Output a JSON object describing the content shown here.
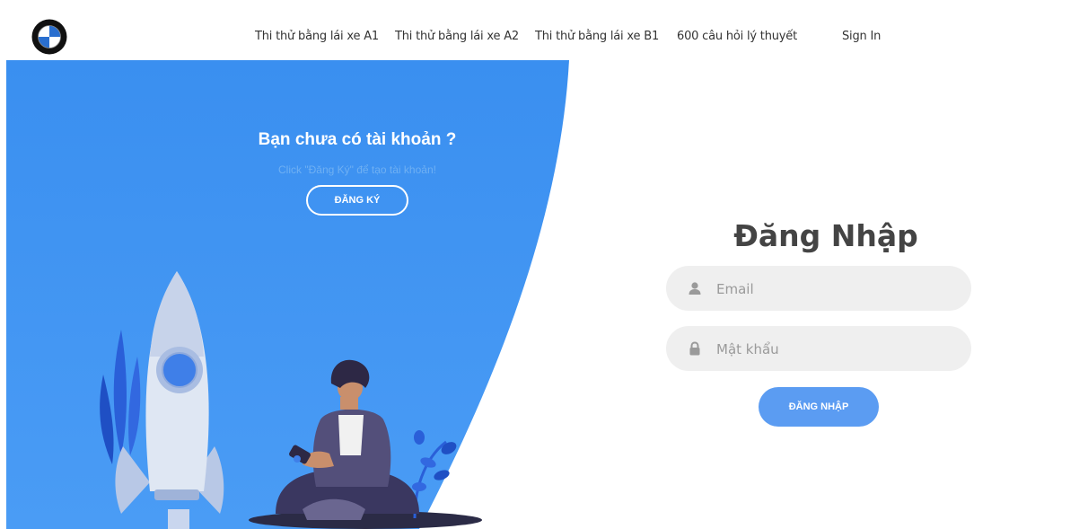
{
  "nav": {
    "links": [
      "Thi thử bằng lái xe A1",
      "Thi thử bằng lái xe A2",
      "Thi thử bằng lái xe B1",
      "600 câu hỏi lý thuyết",
      "Sign In"
    ]
  },
  "signup_panel": {
    "title": "Bạn chưa có tài khoản ?",
    "subtitle": "Click \"Đăng Ký\" để tạo tài khoản!",
    "button_label": "ĐĂNG KÝ"
  },
  "login": {
    "title": "Đăng Nhập",
    "email_placeholder": "Email",
    "password_placeholder": "Mật khẩu",
    "button_label": "ĐĂNG NHẬP"
  },
  "icons": {
    "logo": "bmw-logo",
    "email_field": "user-icon",
    "password_field": "lock-icon"
  },
  "colors": {
    "panel_blue": "#3a8ff0",
    "button_blue": "#5b9cf2"
  }
}
